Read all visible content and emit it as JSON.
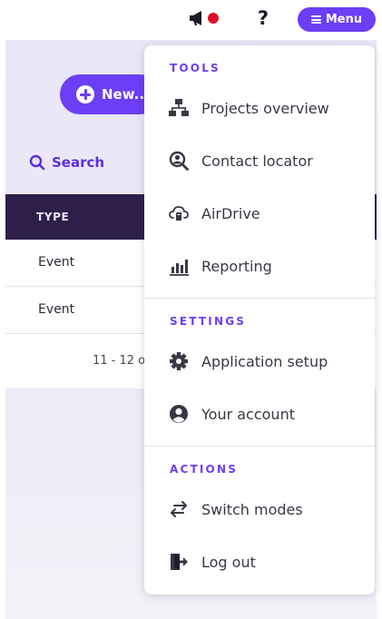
{
  "topbar": {
    "announcement_icon": "megaphone-icon",
    "help_label": "?",
    "menu_label": "Menu"
  },
  "page": {
    "new_button_label": "New...",
    "search_label": "Search",
    "table": {
      "columns": [
        "TYPE"
      ],
      "rows": [
        {
          "type": "Event"
        },
        {
          "type": "Event"
        }
      ]
    },
    "pagination_text": "11 - 12 o"
  },
  "menu": {
    "sections": [
      {
        "title": "TOOLS",
        "items": [
          {
            "label": "Projects overview",
            "icon": "sitemap-icon"
          },
          {
            "label": "Contact locator",
            "icon": "user-search-icon"
          },
          {
            "label": "AirDrive",
            "icon": "cloud-drive-icon"
          },
          {
            "label": "Reporting",
            "icon": "bar-chart-icon"
          }
        ]
      },
      {
        "title": "SETTINGS",
        "items": [
          {
            "label": "Application setup",
            "icon": "gear-icon"
          },
          {
            "label": "Your account",
            "icon": "user-circle-icon"
          }
        ]
      },
      {
        "title": "ACTIONS",
        "items": [
          {
            "label": "Switch modes",
            "icon": "switch-arrows-icon"
          },
          {
            "label": "Log out",
            "icon": "log-out-icon"
          }
        ]
      }
    ]
  },
  "colors": {
    "accent": "#6c3ef5",
    "table_header": "#2e1f4a",
    "notification_dot": "#e0102a"
  }
}
